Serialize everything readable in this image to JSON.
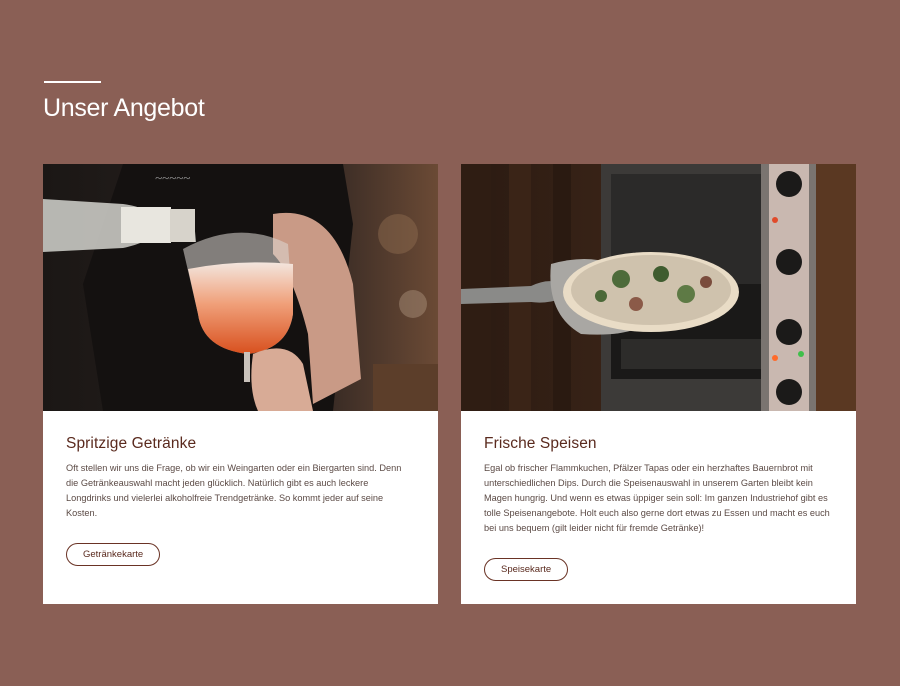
{
  "section": {
    "title": "Unser Angebot"
  },
  "cards": [
    {
      "title": "Spritzige Getränke",
      "text": "Oft stellen wir uns die Frage, ob wir ein Weingarten oder ein Biergarten sind. Denn die Getränkeauswahl macht jeden glücklich. Natürlich gibt es auch leckere Longdrinks und vielerlei alkoholfreie Trendgetränke. So kommt jeder auf seine Kosten.",
      "button": "Getränkekarte"
    },
    {
      "title": "Frische Speisen",
      "text": "Egal ob frischer Flammkuchen, Pfälzer Tapas oder ein herzhaftes Bauernbrot mit unterschiedlichen Dips. Durch die Speisenauswahl in unserem Garten bleibt kein Magen hungrig. Und wenn es etwas üppiger sein soll: Im ganzen Industriehof gibt es tolle Speisenangebote. Holt euch also gerne dort etwas zu Essen und macht es euch bei uns bequem (gilt leider nicht für fremde Getränke)!",
      "button": "Speisekarte"
    }
  ],
  "colors": {
    "background": "#8a5f55",
    "accent": "#5a2a1e"
  }
}
